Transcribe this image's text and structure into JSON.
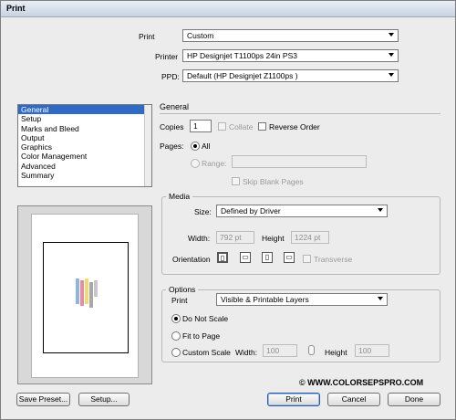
{
  "window": {
    "title": "Print"
  },
  "header": {
    "print_preset": {
      "label": "Print",
      "value": "Custom"
    },
    "printer": {
      "label": "Printer",
      "value": "HP Designjet T1100ps 24in PS3"
    },
    "ppd": {
      "label": "PPD:",
      "value": "Default (HP Designjet Z1100ps )"
    }
  },
  "sidebar": {
    "items": [
      {
        "label": "General",
        "selected": true
      },
      {
        "label": "Setup",
        "selected": false
      },
      {
        "label": "Marks and Bleed",
        "selected": false
      },
      {
        "label": "Output",
        "selected": false
      },
      {
        "label": "Graphics",
        "selected": false
      },
      {
        "label": "Color Management",
        "selected": false
      },
      {
        "label": "Advanced",
        "selected": false
      },
      {
        "label": "Summary",
        "selected": false
      }
    ]
  },
  "general": {
    "title": "General",
    "copies_label": "Copies",
    "copies_value": "1",
    "collate_label": "Collate",
    "reverse_order_label": "Reverse Order",
    "pages_label": "Pages:",
    "all_label": "All",
    "range_label": "Range:",
    "skip_blank_label": "Skip Blank Pages"
  },
  "media": {
    "title": "Media",
    "size_label": "Size:",
    "size_value": "Defined by Driver",
    "width_label": "Width:",
    "width_value": "792 pt",
    "height_label": "Height",
    "height_value": "1224 pt",
    "orientation_label": "Orientation",
    "transverse_label": "Transverse",
    "orientation_icons": [
      "portrait-icon",
      "landscape-icon",
      "reverse-portrait-icon",
      "reverse-landscape-icon"
    ]
  },
  "options": {
    "title": "Options",
    "print_label": "Print",
    "print_value": "Visible & Printable Layers",
    "do_not_scale_label": "Do Not Scale",
    "fit_to_page_label": "Fit to Page",
    "custom_scale_label": "Custom Scale",
    "width_label": "Width:",
    "width_value": "100",
    "height_label": "Height",
    "height_value": "100"
  },
  "watermark": {
    "text": "© WWW.COLORSEPSPRO.COM"
  },
  "footer": {
    "save_preset": "Save Preset...",
    "setup": "Setup...",
    "print": "Print",
    "cancel": "Cancel",
    "done": "Done"
  }
}
